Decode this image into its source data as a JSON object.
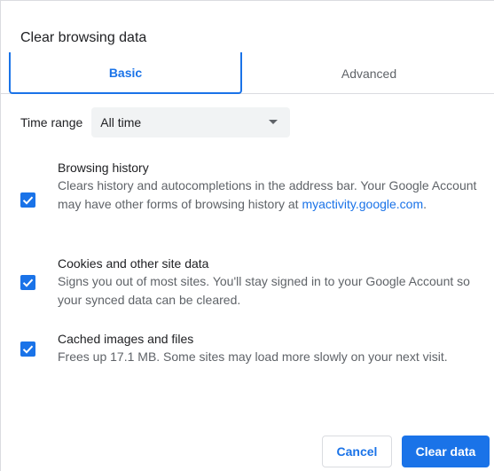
{
  "dialog": {
    "title": "Clear browsing data"
  },
  "tabs": [
    {
      "label": "Basic",
      "selected": true
    },
    {
      "label": "Advanced",
      "selected": false
    }
  ],
  "time_range": {
    "label": "Time range",
    "selected": "All time"
  },
  "options": [
    {
      "title": "Browsing history",
      "desc": "Clears history and autocompletions in the address bar. Your Google Account may have other forms of browsing history at",
      "link": "myactivity.google.com",
      "link_suffix": ".",
      "checked": true
    },
    {
      "title": "Cookies and other site data",
      "desc": "Signs you out of most sites. You'll stay signed in to your Google Account so your synced data can be cleared.",
      "checked": true
    },
    {
      "title": "Cached images and files",
      "desc": "Frees up 17.1 MB. Some sites may load more slowly on your next visit.",
      "checked": true
    }
  ],
  "buttons": {
    "cancel": "Cancel",
    "clear": "Clear data"
  },
  "colors": {
    "accent": "#1a73e8",
    "text": "#202124",
    "secondary_text": "#5f6368",
    "divider": "#dadce0",
    "select_bg": "#f1f3f4"
  }
}
